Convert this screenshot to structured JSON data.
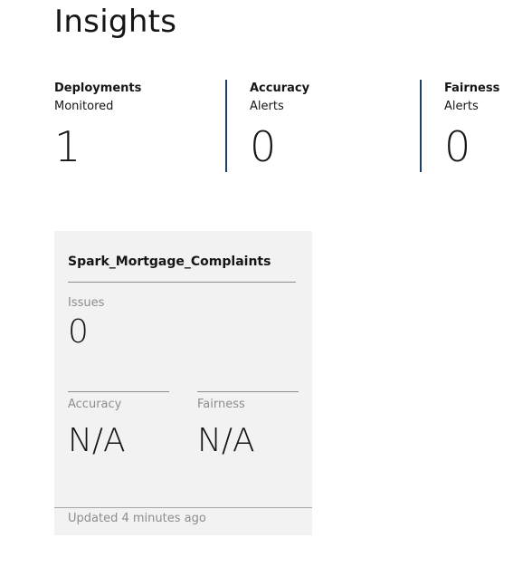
{
  "page": {
    "title": "Insights"
  },
  "stats": [
    {
      "label": "Deployments",
      "sublabel": "Monitored",
      "value": "1"
    },
    {
      "label": "Accuracy",
      "sublabel": "Alerts",
      "value": "0"
    },
    {
      "label": "Fairness",
      "sublabel": "Alerts",
      "value": "0"
    }
  ],
  "deployment_card": {
    "name": "Spark_Mortgage_Complaints",
    "issues_label": "Issues",
    "issues_value": "0",
    "accuracy_label": "Accuracy",
    "accuracy_value": "N/A",
    "fairness_label": "Fairness",
    "fairness_value": "N/A",
    "updated": "Updated 4 minutes ago"
  },
  "colors": {
    "divider": "#1f3f6b",
    "card_background": "#f2f2f2",
    "muted_text": "#8d8d8d"
  }
}
